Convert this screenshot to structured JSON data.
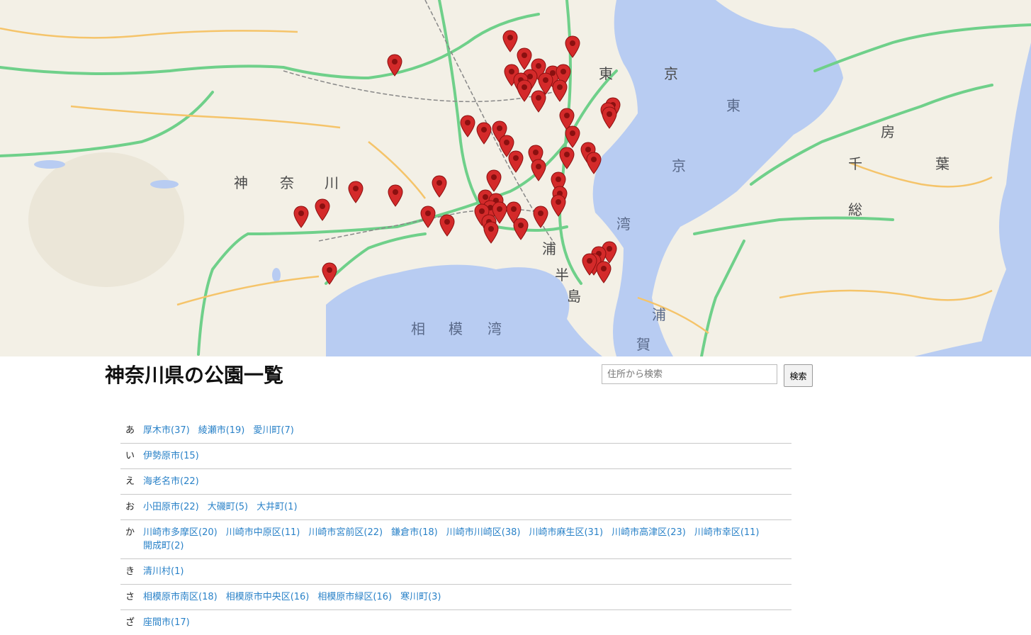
{
  "map": {
    "labels": [
      "神",
      "奈",
      "川",
      "東",
      "京",
      "相",
      "模",
      "湾",
      "浦",
      "半",
      "島",
      "房",
      "千",
      "葉",
      "総",
      "東",
      "京",
      "湾",
      "浦",
      "賀"
    ],
    "colors": {
      "land": "#f3f0e6",
      "water": "#b8ccf2",
      "expressway": "#6fd08a",
      "road": "#f5c46a",
      "marker": "#d42a2a"
    }
  },
  "header": {
    "title": "神奈川県の公園一覧",
    "search_placeholder": "住所から検索",
    "search_button": "検索"
  },
  "rows": [
    {
      "kana": "あ",
      "links": [
        "厚木市(37)",
        "綾瀬市(19)",
        "愛川町(7)"
      ]
    },
    {
      "kana": "い",
      "links": [
        "伊勢原市(15)"
      ]
    },
    {
      "kana": "え",
      "links": [
        "海老名市(22)"
      ]
    },
    {
      "kana": "お",
      "links": [
        "小田原市(22)",
        "大磯町(5)",
        "大井町(1)"
      ]
    },
    {
      "kana": "か",
      "links": [
        "川崎市多摩区(20)",
        "川崎市中原区(11)",
        "川崎市宮前区(22)",
        "鎌倉市(18)",
        "川崎市川崎区(38)",
        "川崎市麻生区(31)",
        "川崎市高津区(23)",
        "川崎市幸区(11)",
        "開成町(2)"
      ]
    },
    {
      "kana": "き",
      "links": [
        "清川村(1)"
      ]
    },
    {
      "kana": "さ",
      "links": [
        "相模原市南区(18)",
        "相模原市中央区(16)",
        "相模原市緑区(16)",
        "寒川町(3)"
      ]
    },
    {
      "kana": "ざ",
      "links": [
        "座間市(17)"
      ]
    }
  ]
}
